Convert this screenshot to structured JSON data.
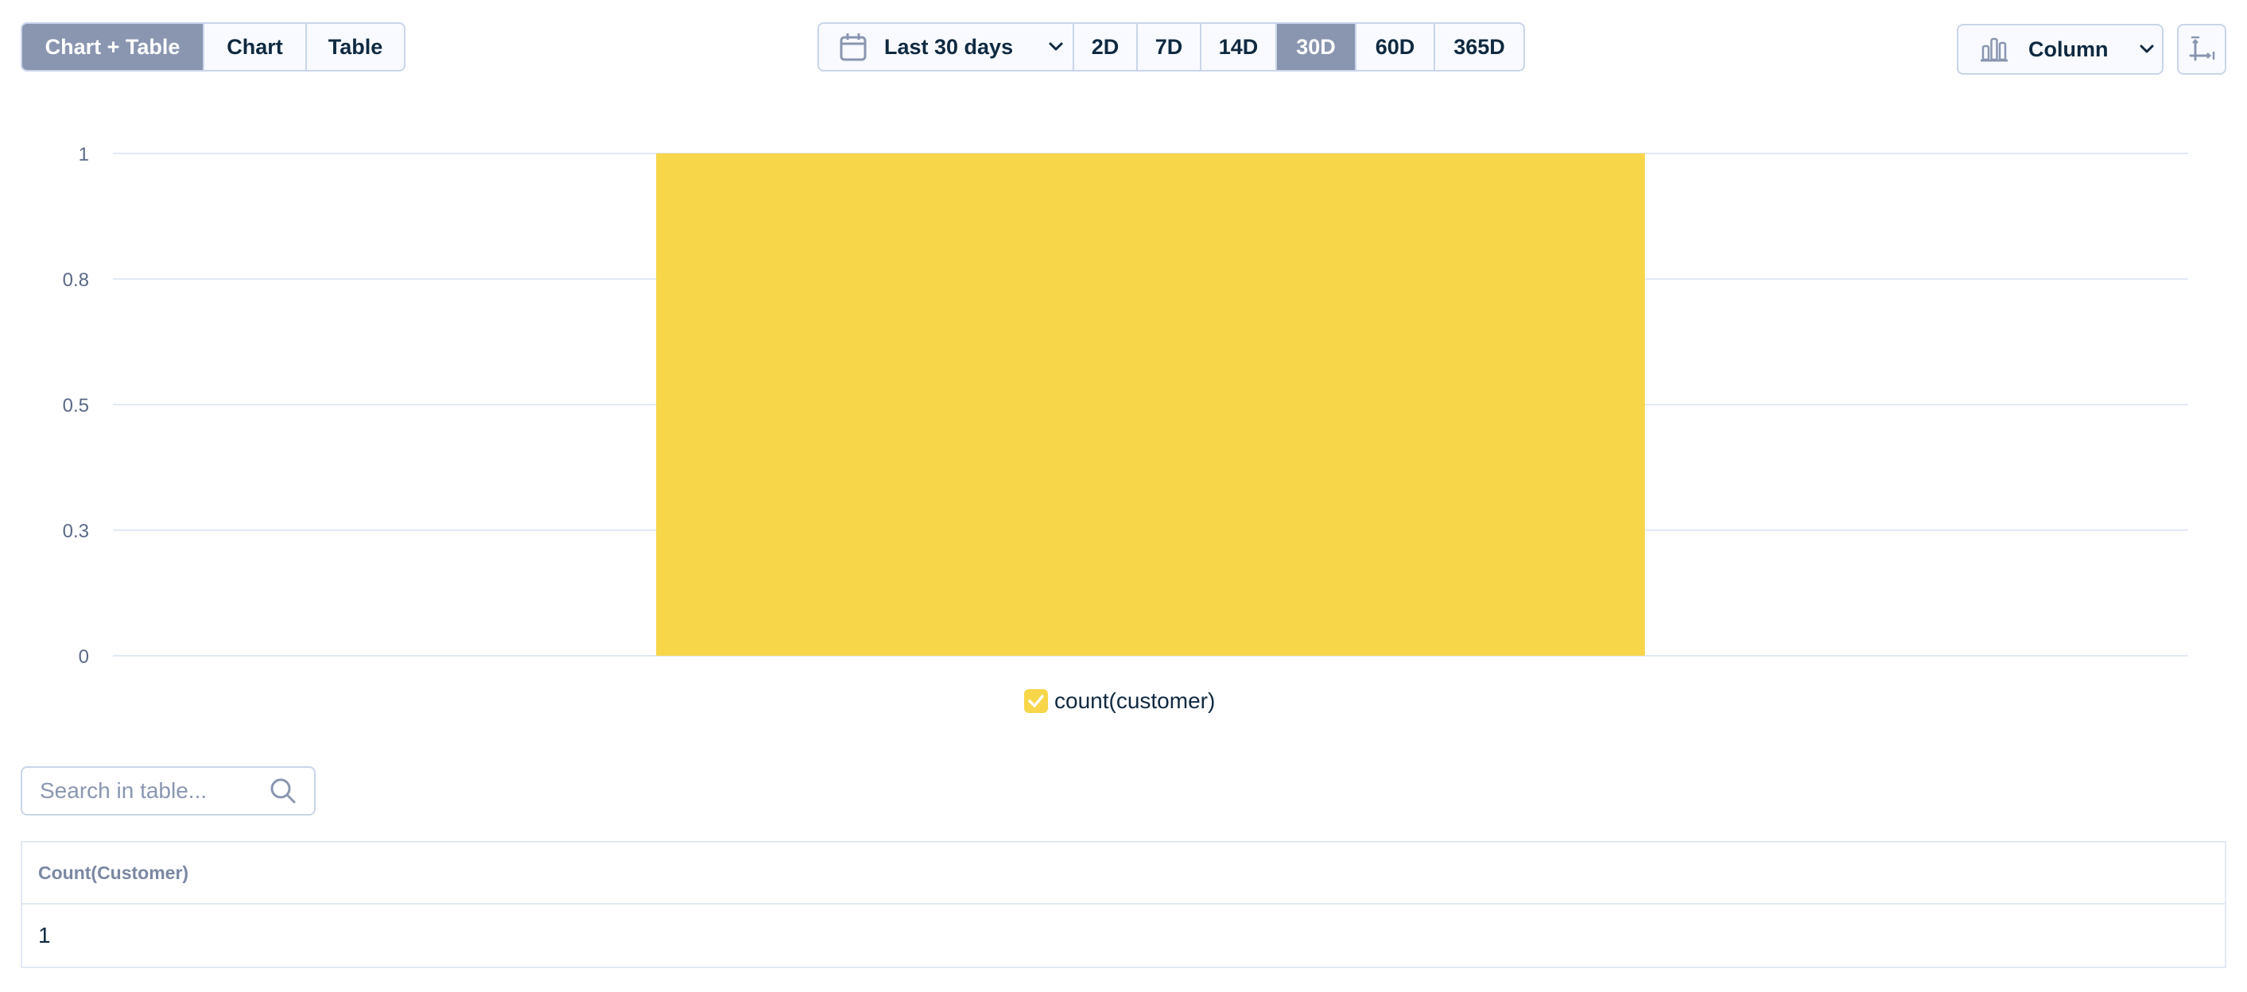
{
  "view_toggle": {
    "options": [
      "Chart + Table",
      "Chart",
      "Table"
    ],
    "selected": "Chart + Table"
  },
  "date_range": {
    "calendar_icon": "calendar-icon",
    "selected_label": "Last 30 days",
    "presets": [
      "2D",
      "7D",
      "14D",
      "30D",
      "60D",
      "365D"
    ],
    "active_preset": "30D"
  },
  "chart_type": {
    "icon": "bar-chart-icon",
    "label": "Column"
  },
  "axis_button": {
    "icon": "axis-settings-icon"
  },
  "colors": {
    "accent": "#8a96b0",
    "series": "#f7d64a",
    "grid": "#e2e9f5",
    "text": "#0f2940",
    "muted": "#5a6a85"
  },
  "chart_data": {
    "type": "bar",
    "title": "",
    "xlabel": "",
    "ylabel": "",
    "categories": [
      ""
    ],
    "series": [
      {
        "name": "count(customer)",
        "values": [
          1
        ],
        "color": "#f7d64a"
      }
    ],
    "ylim": [
      0,
      1
    ],
    "yticks": [
      0,
      0.25,
      0.5,
      0.75,
      1
    ],
    "ytick_labels": [
      "0",
      "0.3",
      "0.5",
      "0.8",
      "1"
    ],
    "grid": true,
    "legend": "bottom-center"
  },
  "legend": {
    "label": "count(customer)",
    "checked": true
  },
  "table": {
    "search_placeholder": "Search in table...",
    "columns": [
      "Count(Customer)"
    ],
    "rows": [
      [
        "1"
      ]
    ]
  }
}
